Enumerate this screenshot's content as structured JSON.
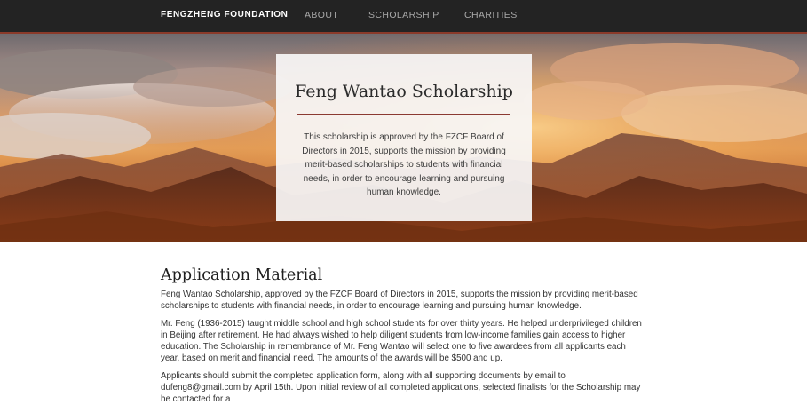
{
  "navbar": {
    "brand": "FENGZHENG FOUNDATION",
    "links": [
      "ABOUT",
      "SCHOLARSHIP",
      "CHARITIES"
    ]
  },
  "hero": {
    "title": "Feng Wantao Scholarship",
    "description": "This scholarship is approved by the FZCF Board of Directors in 2015, supports the mission by providing merit-based scholarships to students with financial needs, in order to encourage learning and pursuing human knowledge."
  },
  "content": {
    "heading": "Application Material",
    "paragraphs": [
      "Feng Wantao Scholarship, approved by the FZCF Board of Directors in 2015, supports the mission by providing merit-based scholarships to students with financial needs, in order to encourage learning and pursuing human knowledge.",
      "Mr. Feng (1936-2015) taught middle school and high school students for over thirty years. He helped underprivileged children in Beijing after retirement. He had always wished to help diligent students from low-income families gain access to higher education. The Scholarship in remembrance of Mr. Feng Wantao will select one to five awardees from all applicants each year, based on merit and financial need. The amounts of the awards will be $500 and up.",
      "Applicants should submit the completed application form, along with all supporting documents by email to dufeng8@gmail.com by April 15th. Upon initial review of all completed applications, selected finalists for the Scholarship may be contacted for a"
    ]
  }
}
